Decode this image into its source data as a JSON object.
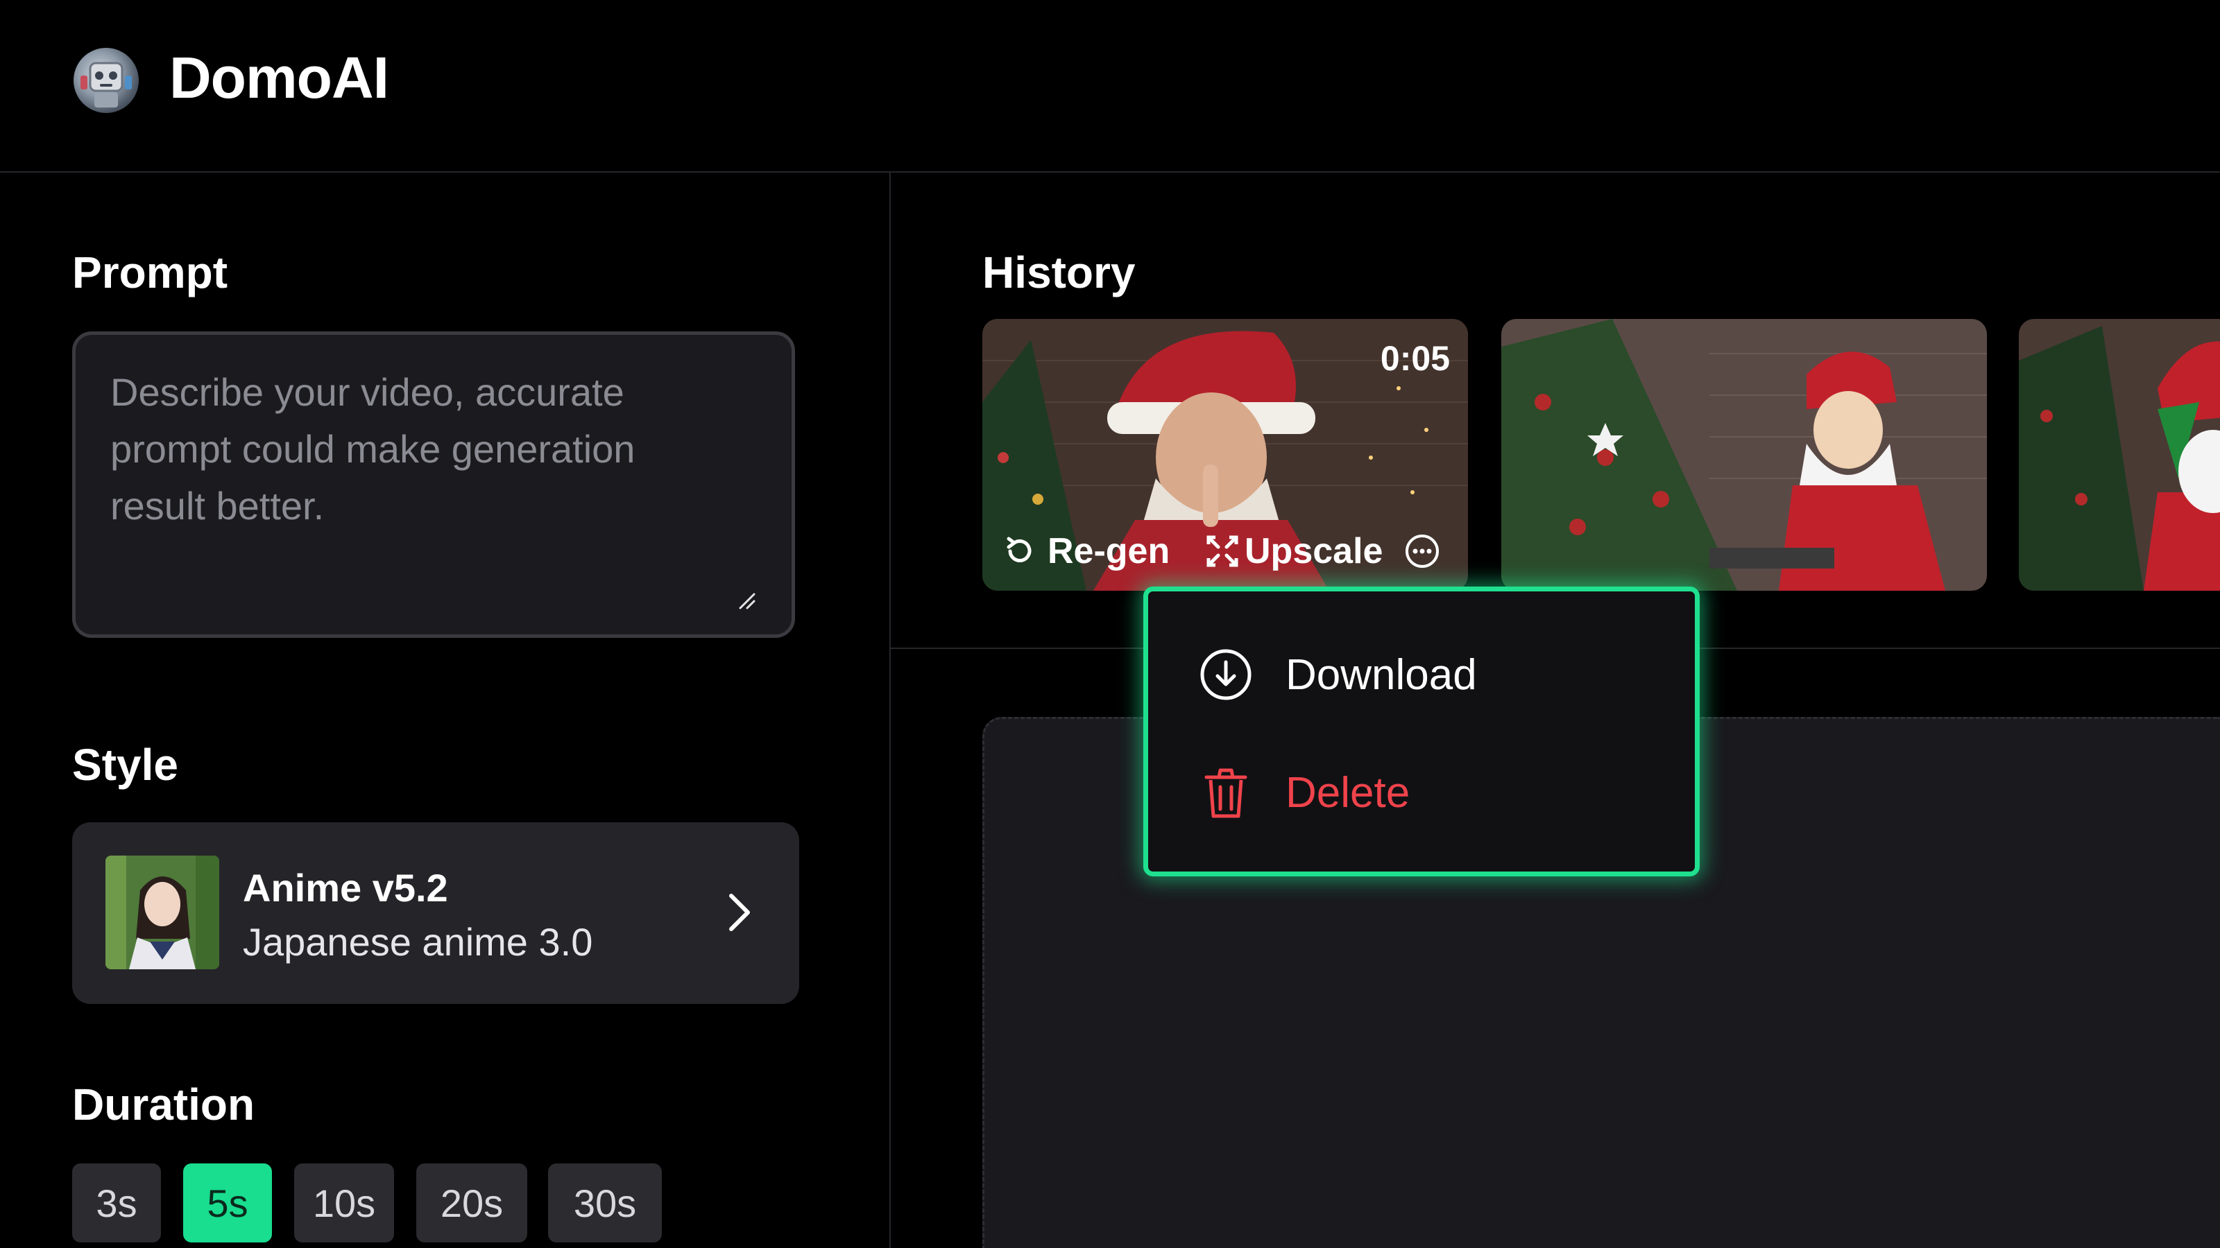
{
  "app": {
    "name": "DomoAI"
  },
  "prompt": {
    "title": "Prompt",
    "placeholder": "Describe your video, accurate prompt could make generation result better.",
    "value": ""
  },
  "style": {
    "title": "Style",
    "name": "Anime v5.2",
    "subtitle": "Japanese anime 3.0"
  },
  "duration": {
    "title": "Duration",
    "options": [
      "3s",
      "5s",
      "10s",
      "20s",
      "30s"
    ],
    "selected": "5s"
  },
  "history": {
    "title": "History",
    "items": [
      {
        "duration": "0:05",
        "actions": {
          "regen": "Re-gen",
          "upscale": "Upscale"
        }
      },
      {},
      {}
    ]
  },
  "context_menu": {
    "download": "Download",
    "delete": "Delete"
  },
  "colors": {
    "accent": "#1fe08f",
    "danger": "#f0434b",
    "background": "#000000",
    "panel": "#1b1b1f"
  },
  "icons": [
    "logo-icon",
    "resize-handle-icon",
    "chevron-right-icon",
    "regen-icon",
    "upscale-icon",
    "more-icon",
    "download-icon",
    "trash-icon"
  ]
}
